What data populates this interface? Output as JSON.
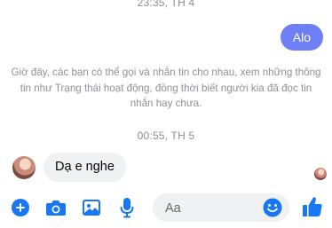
{
  "conversation": {
    "timestamp_top": "23:35, TH 4",
    "sent_message": "Alo",
    "notice": "Giờ đây, các bạn có thể gọi và nhắn tin cho nhau, xem những thông tin như Trạng thái hoạt động, đồng thời biết người kia đã đọc tin nhắn hay chưa.",
    "timestamp_mid": "00:55, TH 5",
    "received_message": "Dạ e nghe"
  },
  "composer": {
    "input_placeholder": "Aa",
    "icons": [
      "plus-icon",
      "camera-icon",
      "image-icon",
      "microphone-icon",
      "emoji-icon",
      "thumbs-up-icon"
    ]
  },
  "colors": {
    "accent": "#1877f2",
    "sent_bubble": "#6f7ff5",
    "received_bubble": "#f0f1f3",
    "meta_text": "#8a8d91"
  }
}
